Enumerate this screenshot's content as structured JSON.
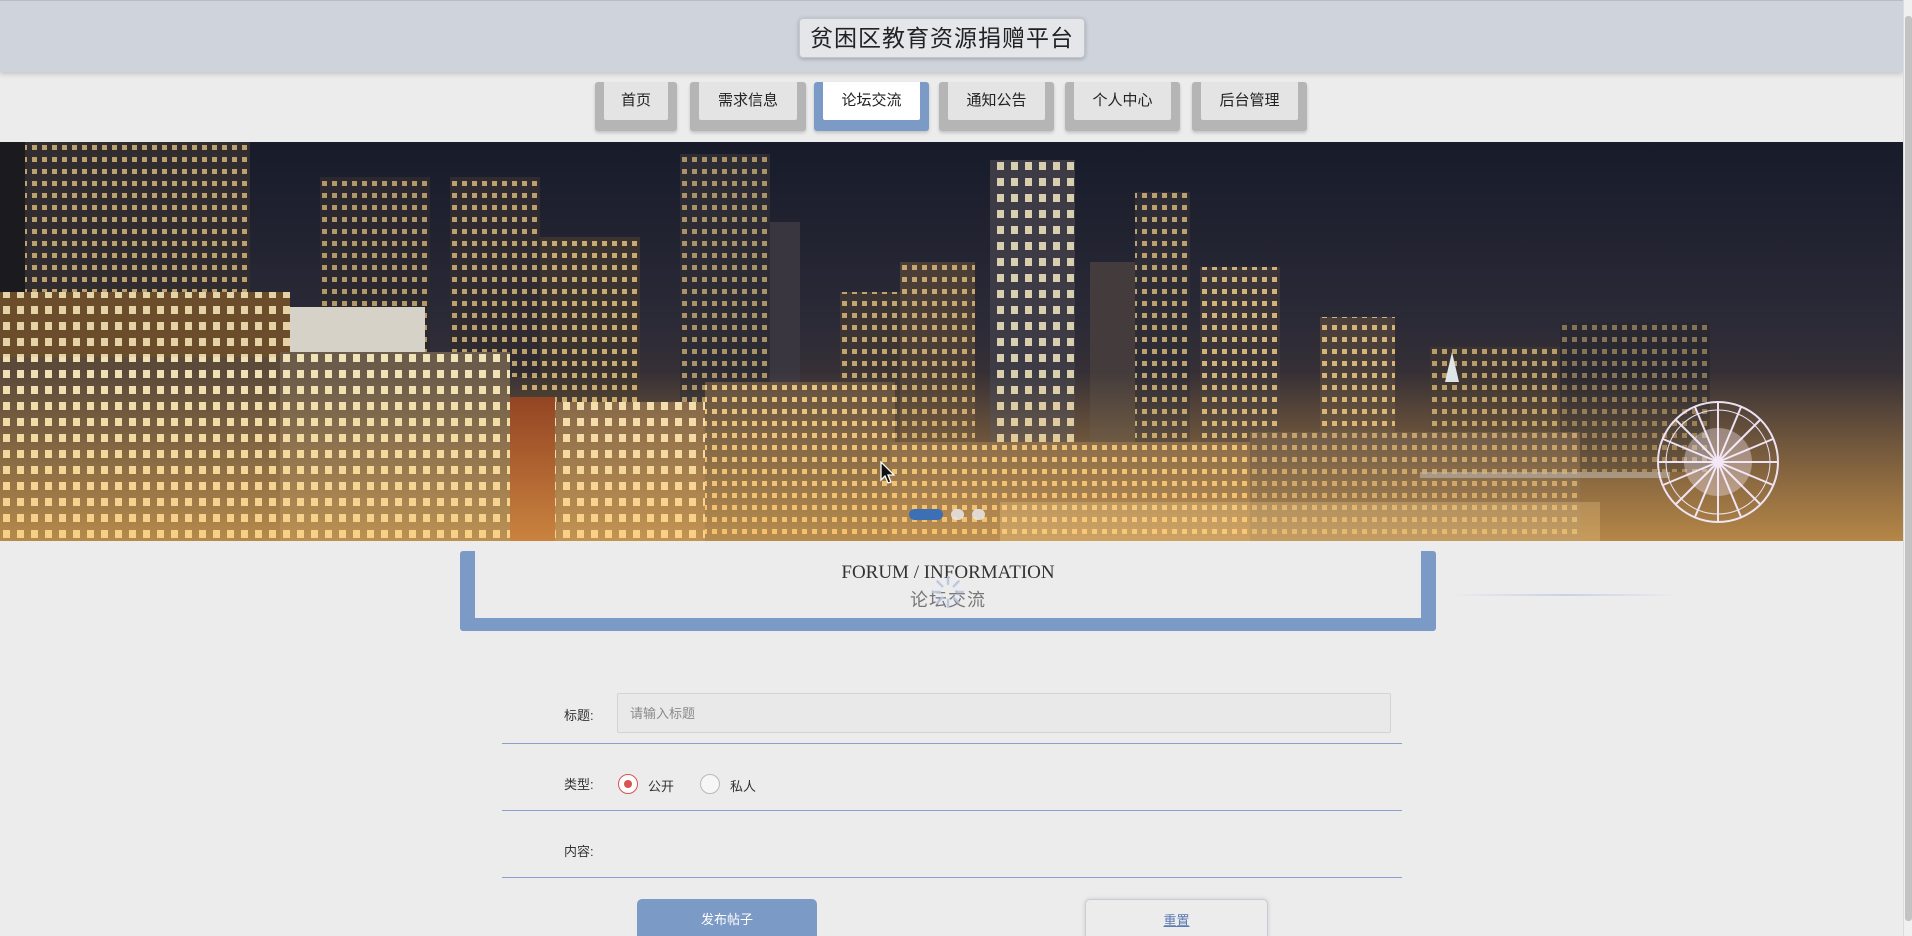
{
  "header": {
    "site_title": "贫困区教育资源捐赠平台"
  },
  "nav": {
    "items": [
      {
        "label": "首页"
      },
      {
        "label": "需求信息"
      },
      {
        "label": "论坛交流"
      },
      {
        "label": "通知公告"
      },
      {
        "label": "个人中心"
      },
      {
        "label": "后台管理"
      }
    ],
    "active_index": 2
  },
  "banner": {
    "slide_count": 3,
    "active_slide": 0
  },
  "section": {
    "title_en": "FORUM / INFORMATION",
    "title_cn": "论坛交流"
  },
  "form": {
    "title_label": "标题:",
    "title_placeholder": "请输入标题",
    "title_value": "",
    "type_label": "类型:",
    "type_options": [
      {
        "label": "公开",
        "checked": true
      },
      {
        "label": "私人",
        "checked": false
      }
    ],
    "content_label": "内容:",
    "submit_label": "发布帖子",
    "reset_label": "重置"
  },
  "colors": {
    "accent": "#7c9ac6",
    "header_bg": "#cfd3dc",
    "page_bg": "#ececec",
    "radio_checked": "#d9534f",
    "underline": "#8c9fd0"
  }
}
